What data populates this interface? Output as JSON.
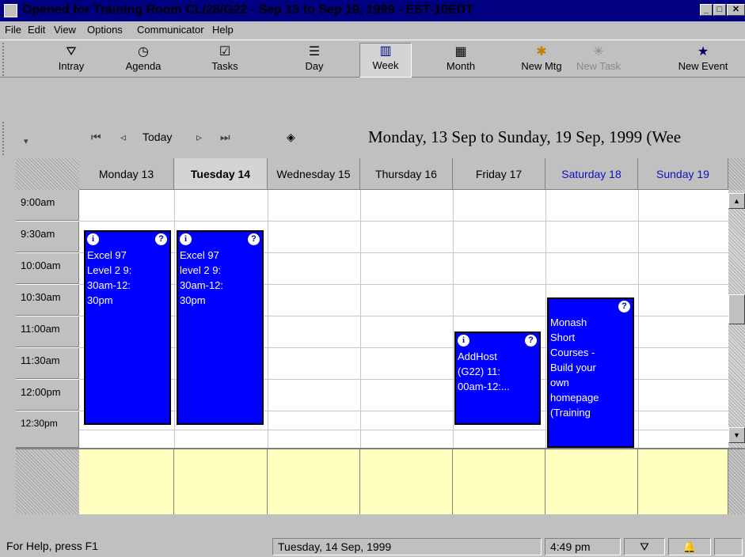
{
  "window": {
    "title": "Opened for Training Room CL/28/G22 - Sep 13  to Sep 19, 1999 - EST-10EDT"
  },
  "menu": [
    "File",
    "Edit",
    "View",
    "Options",
    "Communicator",
    "Help"
  ],
  "toolbar": [
    {
      "label": "Intray",
      "icon": "tray-icon"
    },
    {
      "label": "Agenda",
      "icon": "agenda-icon"
    },
    {
      "label": "Tasks",
      "icon": "tasks-icon"
    },
    {
      "label": "Day",
      "icon": "day-icon"
    },
    {
      "label": "Week",
      "icon": "week-icon",
      "active": true
    },
    {
      "label": "Month",
      "icon": "month-icon"
    },
    {
      "label": "New Mtg",
      "icon": "new-meeting-icon"
    },
    {
      "label": "New Task",
      "icon": "new-task-icon",
      "disabled": true
    },
    {
      "label": "New Event",
      "icon": "new-event-icon"
    }
  ],
  "nav": {
    "today": "Today",
    "range": "Monday, 13 Sep to Sunday, 19 Sep, 1999  (Wee"
  },
  "days": [
    "Monday 13",
    "Tuesday 14",
    "Wednesday 15",
    "Thursday 16",
    "Friday 17",
    "Saturday 18",
    "Sunday 19"
  ],
  "times": [
    "9:00am",
    "9:30am",
    "10:00am",
    "10:30am",
    "11:00am",
    "11:30am",
    "12:00pm",
    "12:30pm"
  ],
  "appointments": [
    {
      "day": "Monday 13",
      "text": "Excel 97\nLevel 2 9:\n30am-12:\n30pm"
    },
    {
      "day": "Tuesday 14",
      "text": "Excel 97\nlevel 2 9:\n30am-12:\n30pm"
    },
    {
      "day": "Friday 17",
      "text": "AddHost\n(G22) 11:\n00am-12:..."
    },
    {
      "day": "Saturday 18",
      "text": "Monash\nShort\nCourses -\nBuild your\nown\nhomepage\n(Training"
    }
  ],
  "status": {
    "help": "For Help, press F1",
    "date": "Tuesday, 14 Sep, 1999",
    "time": "4:49 pm"
  }
}
